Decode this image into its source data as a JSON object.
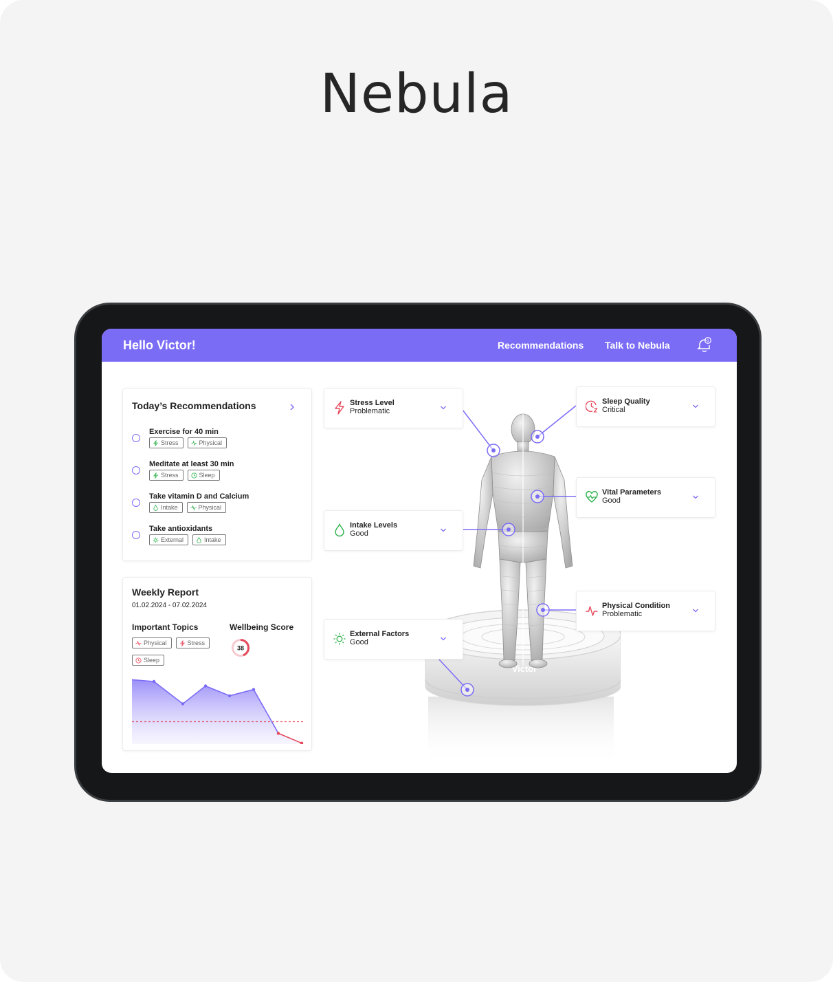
{
  "brand": {
    "title": "Nebula"
  },
  "header": {
    "greeting": "Hello Victor!",
    "nav": [
      "Recommendations",
      "Talk to Nebula"
    ],
    "notification_count": "1"
  },
  "recommendations": {
    "title": "Today’s Recommendations",
    "items": [
      {
        "label": "Exercise for 40 min",
        "tags": [
          "Stress",
          "Physical"
        ]
      },
      {
        "label": "Meditate at least 30 min",
        "tags": [
          "Stress",
          "Sleep"
        ]
      },
      {
        "label": "Take vitamin D and Calcium",
        "tags": [
          "Intake",
          "Physical"
        ]
      },
      {
        "label": "Take antioxidants",
        "tags": [
          "External",
          "Intake"
        ]
      }
    ]
  },
  "weekly_report": {
    "title": "Weekly Report",
    "date_range": "01.02.2024 - 07.02.2024",
    "topics_label": "Important Topics",
    "topics": [
      "Physical",
      "Stress",
      "Sleep"
    ],
    "score_label": "Wellbeing Score",
    "score": "38",
    "trend": [
      72,
      70,
      45,
      65,
      54,
      61,
      12,
      1
    ],
    "threshold": 25
  },
  "metrics": [
    {
      "name": "Stress Level",
      "status": "Problematic",
      "icon": "lightning-icon",
      "color": "#e5485a"
    },
    {
      "name": "Sleep Quality",
      "status": "Critical",
      "icon": "clock-sleep-icon",
      "color": "#e5485a"
    },
    {
      "name": "Vital Parameters",
      "status": "Good",
      "icon": "heart-pulse-icon",
      "color": "#2bb14b"
    },
    {
      "name": "Intake Levels",
      "status": "Good",
      "icon": "droplet-icon",
      "color": "#2bb14b"
    },
    {
      "name": "Physical Condition",
      "status": "Problematic",
      "icon": "pulse-icon",
      "color": "#e5485a"
    },
    {
      "name": "External Factors",
      "status": "Good",
      "icon": "sun-icon",
      "color": "#2bb14b"
    }
  ],
  "avatar": {
    "name": "Victor"
  },
  "colors": {
    "accent": "#7b6cf6",
    "good": "#2bb14b",
    "bad": "#e5485a"
  }
}
